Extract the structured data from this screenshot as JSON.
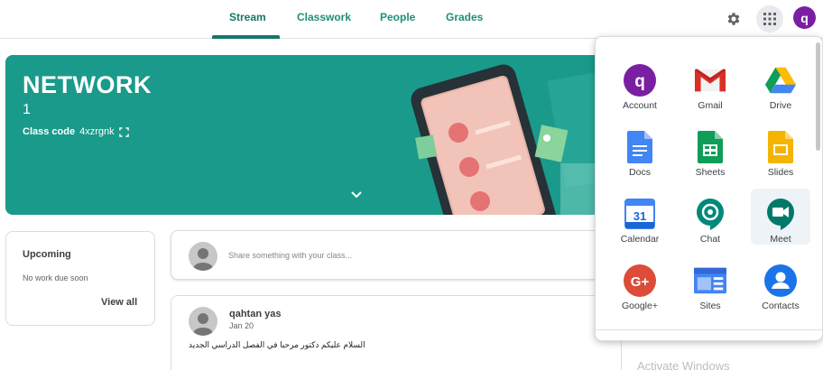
{
  "nav": {
    "tabs": [
      {
        "label": "Stream"
      },
      {
        "label": "Classwork"
      },
      {
        "label": "People"
      },
      {
        "label": "Grades"
      }
    ],
    "avatar_letter": "q"
  },
  "banner": {
    "title": "NETWORK",
    "subtitle": "1",
    "class_code_label": "Class code",
    "class_code_value": "4xzrgnk"
  },
  "upcoming": {
    "title": "Upcoming",
    "empty_text": "No work due soon",
    "view_all": "View all"
  },
  "share": {
    "placeholder": "Share something with your class..."
  },
  "post": {
    "author": "qahtan yas",
    "date": "Jan 20",
    "body": "السلام عليكم دكتور مرحبا في الفصل الدراسي الجديد"
  },
  "apps": [
    {
      "label": "Account",
      "icon": "account-icon"
    },
    {
      "label": "Gmail",
      "icon": "gmail-icon"
    },
    {
      "label": "Drive",
      "icon": "drive-icon"
    },
    {
      "label": "Docs",
      "icon": "docs-icon"
    },
    {
      "label": "Sheets",
      "icon": "sheets-icon"
    },
    {
      "label": "Slides",
      "icon": "slides-icon"
    },
    {
      "label": "Calendar",
      "icon": "calendar-icon",
      "icon_text": "31"
    },
    {
      "label": "Chat",
      "icon": "chat-icon"
    },
    {
      "label": "Meet",
      "icon": "meet-icon"
    },
    {
      "label": "Google+",
      "icon": "google-plus-icon",
      "icon_text": "G+"
    },
    {
      "label": "Sites",
      "icon": "sites-icon"
    },
    {
      "label": "Contacts",
      "icon": "contacts-icon"
    }
  ],
  "watermark": "Activate Windows",
  "colors": {
    "theme": "#1a9a8a",
    "tab_accent": "#137868",
    "avatar": "#7b1fa2"
  }
}
